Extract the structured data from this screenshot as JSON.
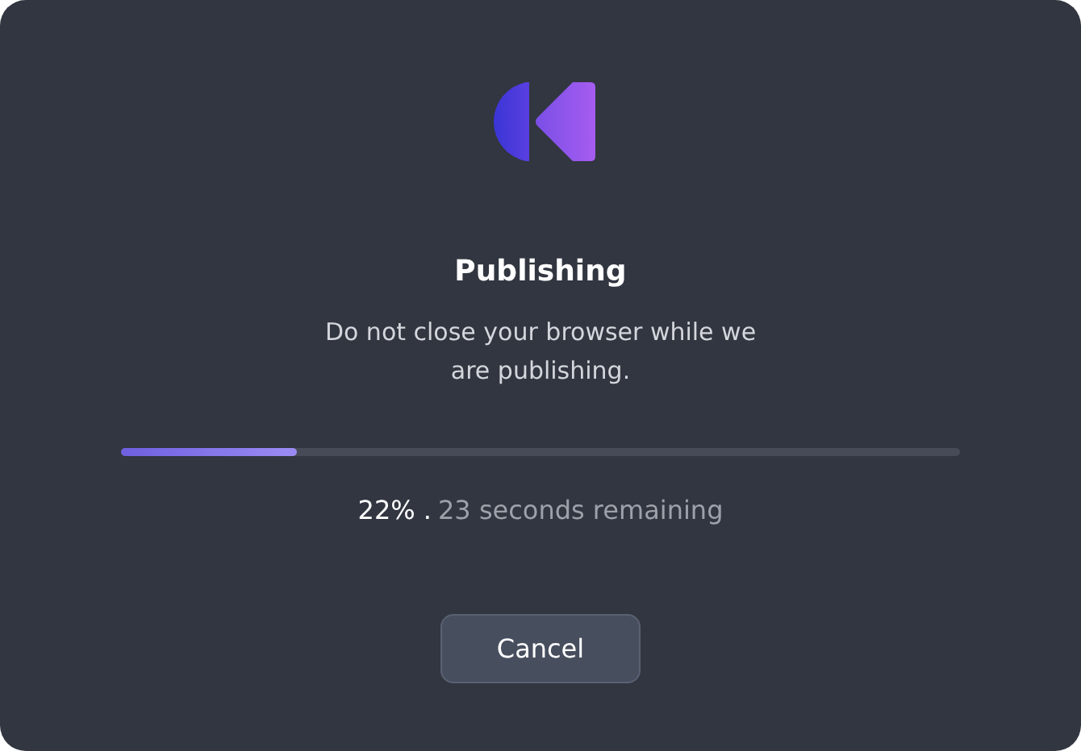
{
  "dialog": {
    "title": "Publishing",
    "message": "Do not close your browser while we are publishing.",
    "progress": {
      "level": 0.21,
      "percent": "22% .",
      "remaining": "23 seconds remaining"
    },
    "buttons": [
      "Cancel"
    ]
  }
}
